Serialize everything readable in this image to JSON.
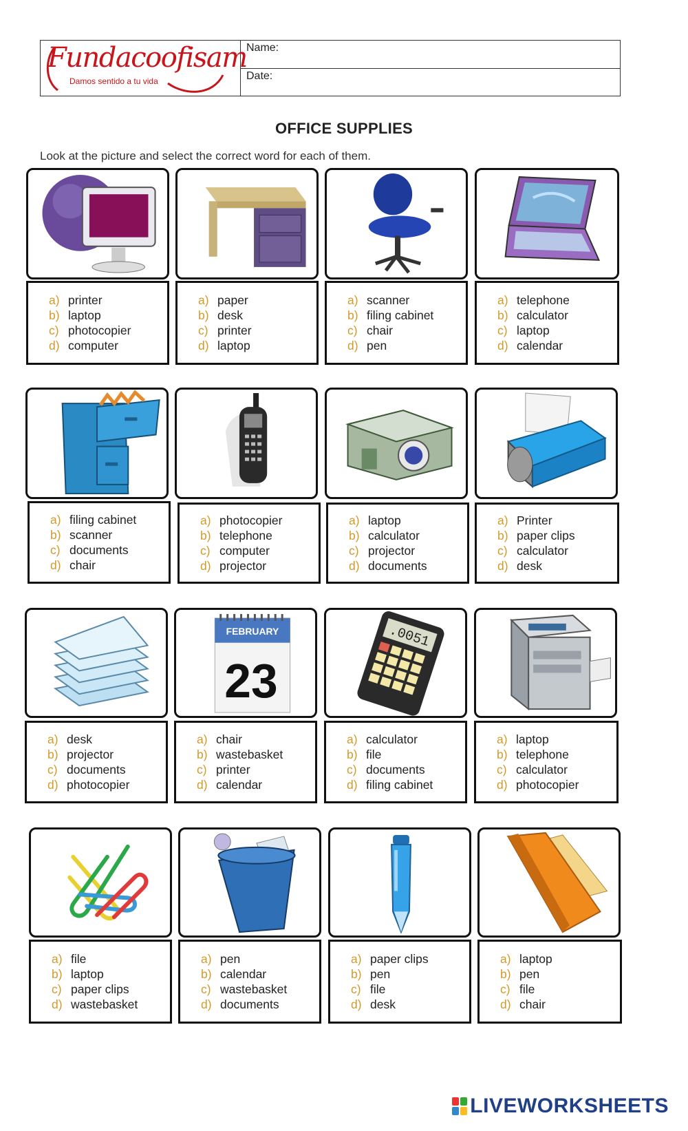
{
  "header": {
    "logo_text": "Fundacoofisam",
    "logo_tagline": "Damos sentido a tu vida",
    "name_label": "Name:",
    "date_label": "Date:"
  },
  "title": "OFFICE SUPPLIES",
  "instructions": "Look at the picture and select the correct word for each of them.",
  "footer": "LIVEWORKSHEETS",
  "colors": {
    "option_letter": "#d49a2a",
    "logo_red": "#c8151b",
    "footer_blue": "#1f3f86"
  },
  "questions": [
    {
      "picture": "computer-icon",
      "options": [
        {
          "letter": "a)",
          "text": "printer"
        },
        {
          "letter": "b)",
          "text": "laptop"
        },
        {
          "letter": "c)",
          "text": "photocopier"
        },
        {
          "letter": "d)",
          "text": "computer"
        }
      ]
    },
    {
      "picture": "desk-icon",
      "options": [
        {
          "letter": "a)",
          "text": "paper"
        },
        {
          "letter": "b)",
          "text": "desk"
        },
        {
          "letter": "c)",
          "text": "printer"
        },
        {
          "letter": "d)",
          "text": "laptop"
        }
      ]
    },
    {
      "picture": "chair-icon",
      "options": [
        {
          "letter": "a)",
          "text": "scanner"
        },
        {
          "letter": "b)",
          "text": "filing cabinet"
        },
        {
          "letter": "c)",
          "text": "chair"
        },
        {
          "letter": "d)",
          "text": "pen"
        }
      ]
    },
    {
      "picture": "laptop-icon",
      "options": [
        {
          "letter": "a)",
          "text": "telephone"
        },
        {
          "letter": "b)",
          "text": "calculator"
        },
        {
          "letter": "c)",
          "text": "laptop"
        },
        {
          "letter": "d)",
          "text": "calendar"
        }
      ]
    },
    {
      "picture": "filing-cabinet-icon",
      "options": [
        {
          "letter": "a)",
          "text": "filing cabinet"
        },
        {
          "letter": "b)",
          "text": "scanner"
        },
        {
          "letter": "c)",
          "text": "documents"
        },
        {
          "letter": "d)",
          "text": "chair"
        }
      ]
    },
    {
      "picture": "telephone-icon",
      "options": [
        {
          "letter": "a)",
          "text": "photocopier"
        },
        {
          "letter": "b)",
          "text": "telephone"
        },
        {
          "letter": "c)",
          "text": "computer"
        },
        {
          "letter": "d)",
          "text": "projector"
        }
      ]
    },
    {
      "picture": "projector-icon",
      "options": [
        {
          "letter": "a)",
          "text": "laptop"
        },
        {
          "letter": "b)",
          "text": "calculator"
        },
        {
          "letter": "c)",
          "text": "projector"
        },
        {
          "letter": "d)",
          "text": "documents"
        }
      ]
    },
    {
      "picture": "printer-icon",
      "options": [
        {
          "letter": "a)",
          "text": "Printer"
        },
        {
          "letter": "b)",
          "text": "paper clips"
        },
        {
          "letter": "c)",
          "text": "calculator"
        },
        {
          "letter": "d)",
          "text": "desk"
        }
      ]
    },
    {
      "picture": "documents-icon",
      "options": [
        {
          "letter": "a)",
          "text": "desk"
        },
        {
          "letter": "b)",
          "text": "projector"
        },
        {
          "letter": "c)",
          "text": "documents"
        },
        {
          "letter": "d)",
          "text": "photocopier"
        }
      ]
    },
    {
      "picture": "calendar-icon",
      "picture_text": [
        "FEBRUARY",
        "23"
      ],
      "options": [
        {
          "letter": "a)",
          "text": "chair"
        },
        {
          "letter": "b)",
          "text": "wastebasket"
        },
        {
          "letter": "c)",
          "text": "printer"
        },
        {
          "letter": "d)",
          "text": "calendar"
        }
      ]
    },
    {
      "picture": "calculator-icon",
      "picture_text": [
        ".0051"
      ],
      "options": [
        {
          "letter": "a)",
          "text": "calculator"
        },
        {
          "letter": "b)",
          "text": "file"
        },
        {
          "letter": "c)",
          "text": "documents"
        },
        {
          "letter": "d)",
          "text": "filing cabinet"
        }
      ]
    },
    {
      "picture": "photocopier-icon",
      "options": [
        {
          "letter": "a)",
          "text": "laptop"
        },
        {
          "letter": "b)",
          "text": "telephone"
        },
        {
          "letter": "c)",
          "text": "calculator"
        },
        {
          "letter": "d)",
          "text": "photocopier"
        }
      ]
    },
    {
      "picture": "paper-clips-icon",
      "options": [
        {
          "letter": "a)",
          "text": "file"
        },
        {
          "letter": "b)",
          "text": "laptop"
        },
        {
          "letter": "c)",
          "text": "paper clips"
        },
        {
          "letter": "d)",
          "text": "wastebasket"
        }
      ]
    },
    {
      "picture": "wastebasket-icon",
      "options": [
        {
          "letter": "a)",
          "text": "pen"
        },
        {
          "letter": "b)",
          "text": "calendar"
        },
        {
          "letter": "c)",
          "text": "wastebasket"
        },
        {
          "letter": "d)",
          "text": "documents"
        }
      ]
    },
    {
      "picture": "pen-icon",
      "options": [
        {
          "letter": "a)",
          "text": "paper clips"
        },
        {
          "letter": "b)",
          "text": "pen"
        },
        {
          "letter": "c)",
          "text": "file"
        },
        {
          "letter": "d)",
          "text": "desk"
        }
      ]
    },
    {
      "picture": "file-folder-icon",
      "options": [
        {
          "letter": "a)",
          "text": "laptop"
        },
        {
          "letter": "b)",
          "text": "pen"
        },
        {
          "letter": "c)",
          "text": "file"
        },
        {
          "letter": "d)",
          "text": "chair"
        }
      ]
    }
  ]
}
